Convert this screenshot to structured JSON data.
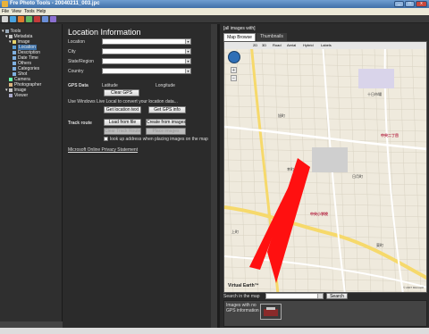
{
  "window": {
    "title": "Fre Photo Tools - 20040211_003.jpc",
    "min": "_",
    "max": "□",
    "close": "x"
  },
  "menu": [
    "File",
    "View",
    "Tools",
    "Help"
  ],
  "toolbar": {
    "colors": [
      "#d4d4d4",
      "#4aa3e0",
      "#e07a2e",
      "#5fb85f",
      "#c43a3a",
      "#6a8fd8",
      "#8b6fd0"
    ]
  },
  "tree": {
    "items": [
      {
        "label": "Tools",
        "icon": "tools-icon",
        "expander": "▾",
        "selected": false
      },
      {
        "label": "Metadata",
        "icon": "metadata-icon",
        "expander": "▾",
        "selected": false
      },
      {
        "label": "Image",
        "icon": "folder-icon",
        "expander": "▾",
        "selected": false
      },
      {
        "label": "Location",
        "icon": "location-icon",
        "expander": "",
        "selected": true
      },
      {
        "label": "Description",
        "icon": "description-icon",
        "expander": "",
        "selected": false
      },
      {
        "label": "Date Time",
        "icon": "datetime-icon",
        "expander": "",
        "selected": false
      },
      {
        "label": "Others",
        "icon": "others-icon",
        "expander": "",
        "selected": false
      },
      {
        "label": "Categories",
        "icon": "categories-icon",
        "expander": "",
        "selected": false
      },
      {
        "label": "Shot",
        "icon": "shot-icon",
        "expander": "",
        "selected": false
      },
      {
        "label": "Camera",
        "icon": "camera-icon",
        "expander": "",
        "selected": false
      },
      {
        "label": "Photographer",
        "icon": "photographer-icon",
        "expander": "",
        "selected": false
      },
      {
        "label": "Image",
        "icon": "image-icon",
        "expander": "▾",
        "selected": false
      },
      {
        "label": "Viewer",
        "icon": "viewer-icon",
        "expander": "",
        "selected": false
      }
    ]
  },
  "form": {
    "title": "Location Information",
    "fields": [
      {
        "label": "Location",
        "value": ""
      },
      {
        "label": "City",
        "value": ""
      },
      {
        "label": "State/Region",
        "value": ""
      },
      {
        "label": "Country",
        "value": ""
      }
    ],
    "gps": {
      "section": "GPS Data",
      "latitude": "Latitude",
      "longitude": "Longitude",
      "clear": "Clear GPS"
    },
    "live_local_text": "Use Windows Live Local to convert your location data...",
    "buttons": {
      "get_location": "Get location text",
      "get_gps": "Get GPS info"
    },
    "track": {
      "section": "Track route",
      "load": "Load from file",
      "create": "Create from images",
      "clear": "Clear Track Route",
      "place": "Place images"
    },
    "lookup_label": "look up address when placing images on the map",
    "privacy_link": "Microsoft Online Privacy Statement"
  },
  "right": {
    "title": "[all images with]",
    "tabs": [
      "Map Browse",
      "Thumbnails"
    ],
    "map": {
      "modes": [
        "2D",
        "3D",
        "Road",
        "Aerial",
        "Hybrid",
        "Labels"
      ],
      "zoom_in": "+",
      "zoom_out": "−",
      "labels": [
        "十日市場",
        "中央二丁目",
        "日月町",
        "中央小学校",
        "旭町",
        "上町",
        "東町",
        "幸町"
      ],
      "logo": "Virtual Earth™",
      "copyright": "© 2007 Microsoft"
    },
    "search": {
      "label": "Search in the map",
      "value": "",
      "button": "Search"
    },
    "no_gps": {
      "label": "Images with no GPS information"
    }
  }
}
